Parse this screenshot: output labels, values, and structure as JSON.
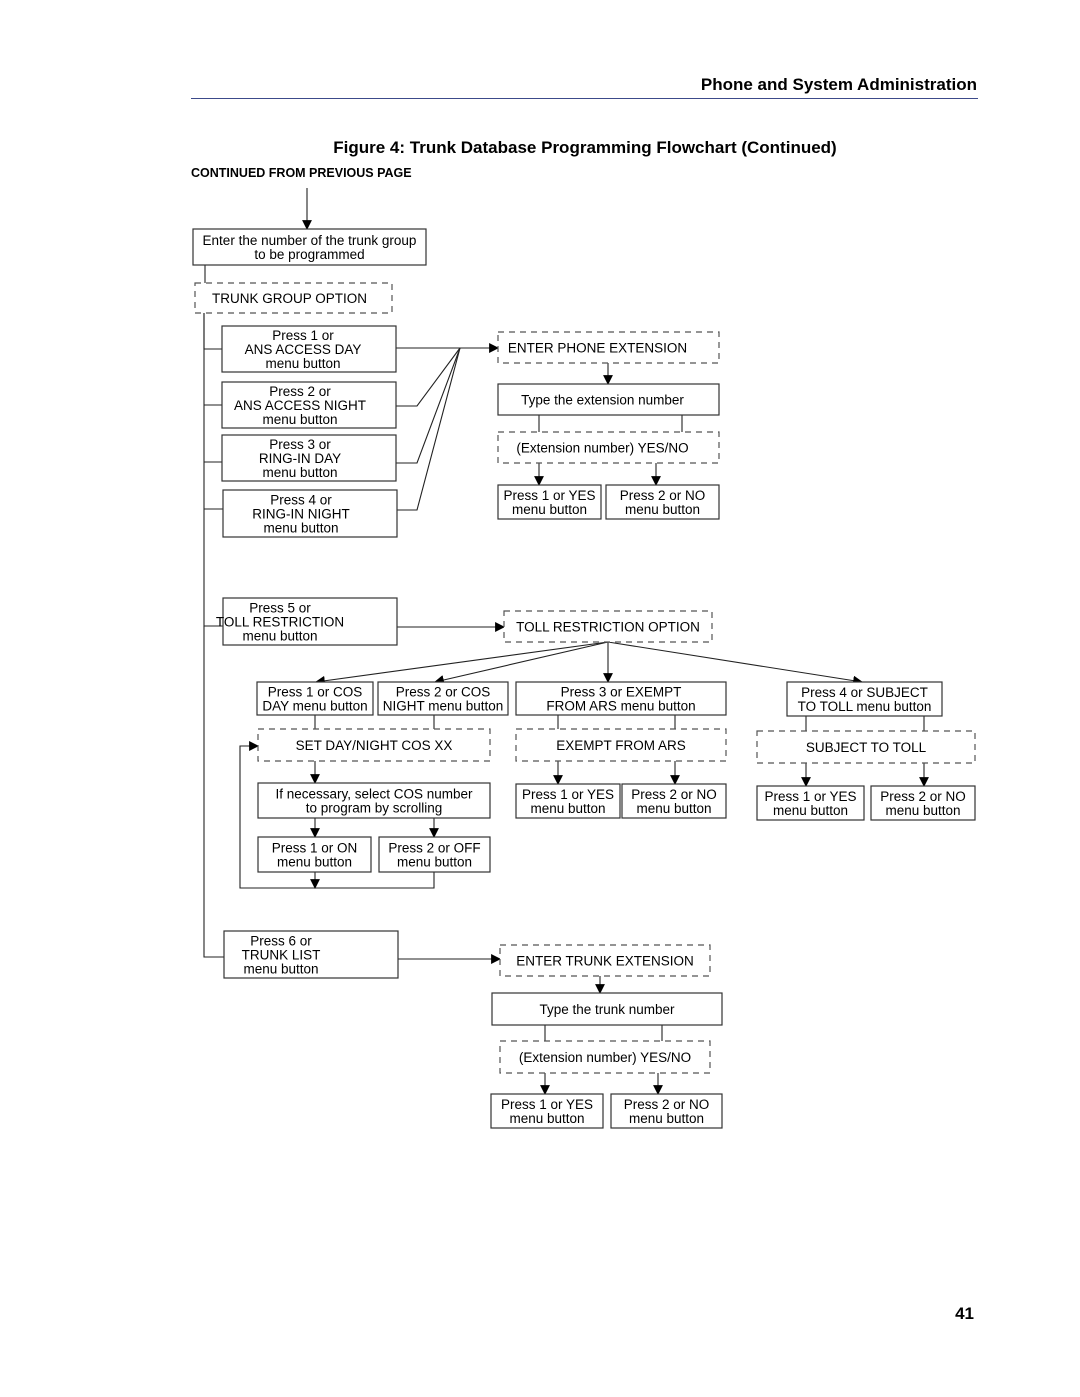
{
  "header": {
    "title": "Phone and System Administration"
  },
  "figure": {
    "title": "Figure 4: Trunk Database Programming Flowchart (Continued)"
  },
  "continued_label": "CONTINUED FROM PREVIOUS PAGE",
  "page_number": "41",
  "flowchart": {
    "nodes": [
      {
        "id": "enter-trunk-group",
        "style": "solid",
        "lines": [
          "Enter the number of the trunk group",
          "to be programmed"
        ]
      },
      {
        "id": "trunk-group-option",
        "style": "dashed",
        "lines": [
          "TRUNK GROUP OPTION"
        ]
      },
      {
        "id": "ans-access-day",
        "style": "solid",
        "lines": [
          "Press 1 or",
          "ANS ACCESS DAY",
          "menu button"
        ]
      },
      {
        "id": "ans-access-night",
        "style": "solid",
        "lines": [
          "Press 2 or",
          "ANS ACCESS NIGHT",
          "menu button"
        ]
      },
      {
        "id": "ring-in-day",
        "style": "solid",
        "lines": [
          "Press 3 or",
          "RING-IN DAY",
          "menu button"
        ]
      },
      {
        "id": "ring-in-night",
        "style": "solid",
        "lines": [
          "Press 4 or",
          "RING-IN NIGHT",
          "menu button"
        ]
      },
      {
        "id": "enter-phone-extension",
        "style": "dashed",
        "lines": [
          "ENTER PHONE EXTENSION"
        ]
      },
      {
        "id": "type-extension-number",
        "style": "solid",
        "lines": [
          "Type the extension number"
        ]
      },
      {
        "id": "extension-yes-no-1",
        "style": "dashed",
        "lines": [
          "(Extension number) YES/NO"
        ]
      },
      {
        "id": "ext-yes-1",
        "style": "solid",
        "lines": [
          "Press 1 or YES",
          "menu button"
        ]
      },
      {
        "id": "ext-no-1",
        "style": "solid",
        "lines": [
          "Press 2 or NO",
          "menu button"
        ]
      },
      {
        "id": "toll-restriction",
        "style": "solid",
        "lines": [
          "Press 5 or",
          "TOLL RESTRICTION",
          "menu button"
        ]
      },
      {
        "id": "toll-restriction-option",
        "style": "dashed",
        "lines": [
          "TOLL RESTRICTION OPTION"
        ]
      },
      {
        "id": "cos-day",
        "style": "solid",
        "lines": [
          "Press 1 or COS",
          "DAY menu button"
        ]
      },
      {
        "id": "cos-night",
        "style": "solid",
        "lines": [
          "Press 2 or COS",
          "NIGHT menu button"
        ]
      },
      {
        "id": "exempt-from-ars-button",
        "style": "solid",
        "lines": [
          "Press 3 or EXEMPT",
          "FROM ARS menu button"
        ]
      },
      {
        "id": "subject-to-toll-button",
        "style": "solid",
        "lines": [
          "Press 4 or SUBJECT",
          "TO TOLL menu button"
        ]
      },
      {
        "id": "set-day-night-cos",
        "style": "dashed",
        "lines": [
          "SET DAY/NIGHT COS XX"
        ]
      },
      {
        "id": "select-cos-number",
        "style": "solid",
        "lines": [
          "If necessary, select COS number",
          "to program by scrolling"
        ]
      },
      {
        "id": "cos-on",
        "style": "solid",
        "lines": [
          "Press 1 or ON",
          "menu button"
        ]
      },
      {
        "id": "cos-off",
        "style": "solid",
        "lines": [
          "Press 2 or OFF",
          "menu button"
        ]
      },
      {
        "id": "exempt-from-ars",
        "style": "dashed",
        "lines": [
          "EXEMPT FROM ARS"
        ]
      },
      {
        "id": "ars-yes",
        "style": "solid",
        "lines": [
          "Press 1 or YES",
          "menu button"
        ]
      },
      {
        "id": "ars-no",
        "style": "solid",
        "lines": [
          "Press 2 or NO",
          "menu button"
        ]
      },
      {
        "id": "subject-to-toll",
        "style": "dashed",
        "lines": [
          "SUBJECT TO TOLL"
        ]
      },
      {
        "id": "toll-yes",
        "style": "solid",
        "lines": [
          "Press 1 or YES",
          "menu button"
        ]
      },
      {
        "id": "toll-no",
        "style": "solid",
        "lines": [
          "Press 2 or NO",
          "menu button"
        ]
      },
      {
        "id": "trunk-list",
        "style": "solid",
        "lines": [
          "Press 6 or",
          "TRUNK LIST",
          "menu button"
        ]
      },
      {
        "id": "enter-trunk-extension",
        "style": "dashed",
        "lines": [
          "ENTER TRUNK EXTENSION"
        ]
      },
      {
        "id": "type-trunk-number",
        "style": "solid",
        "lines": [
          "Type the trunk number"
        ]
      },
      {
        "id": "extension-yes-no-2",
        "style": "dashed",
        "lines": [
          "(Extension number) YES/NO"
        ]
      },
      {
        "id": "ext-yes-2",
        "style": "solid",
        "lines": [
          "Press 1 or YES",
          "menu button"
        ]
      },
      {
        "id": "ext-no-2",
        "style": "solid",
        "lines": [
          "Press 2 or NO",
          "menu button"
        ]
      }
    ],
    "edges": [
      {
        "from": "previous-page",
        "to": "enter-trunk-group"
      },
      {
        "from": "enter-trunk-group",
        "to": "trunk-group-option"
      },
      {
        "from": "trunk-group-option",
        "to": "ans-access-day"
      },
      {
        "from": "trunk-group-option",
        "to": "ans-access-night"
      },
      {
        "from": "trunk-group-option",
        "to": "ring-in-day"
      },
      {
        "from": "trunk-group-option",
        "to": "ring-in-night"
      },
      {
        "from": "trunk-group-option",
        "to": "toll-restriction"
      },
      {
        "from": "trunk-group-option",
        "to": "trunk-list"
      },
      {
        "from": "ans-access-day",
        "to": "enter-phone-extension"
      },
      {
        "from": "ans-access-night",
        "to": "enter-phone-extension"
      },
      {
        "from": "ring-in-day",
        "to": "enter-phone-extension"
      },
      {
        "from": "ring-in-night",
        "to": "enter-phone-extension"
      },
      {
        "from": "enter-phone-extension",
        "to": "type-extension-number"
      },
      {
        "from": "type-extension-number",
        "to": "extension-yes-no-1"
      },
      {
        "from": "extension-yes-no-1",
        "to": "ext-yes-1"
      },
      {
        "from": "extension-yes-no-1",
        "to": "ext-no-1"
      },
      {
        "from": "toll-restriction",
        "to": "toll-restriction-option"
      },
      {
        "from": "toll-restriction-option",
        "to": "cos-day"
      },
      {
        "from": "toll-restriction-option",
        "to": "cos-night"
      },
      {
        "from": "toll-restriction-option",
        "to": "exempt-from-ars-button"
      },
      {
        "from": "toll-restriction-option",
        "to": "subject-to-toll-button"
      },
      {
        "from": "cos-day",
        "to": "set-day-night-cos"
      },
      {
        "from": "cos-night",
        "to": "set-day-night-cos"
      },
      {
        "from": "set-day-night-cos",
        "to": "select-cos-number"
      },
      {
        "from": "select-cos-number",
        "to": "cos-on"
      },
      {
        "from": "select-cos-number",
        "to": "cos-off"
      },
      {
        "from": "cos-on",
        "to": "set-day-night-cos"
      },
      {
        "from": "cos-off",
        "to": "set-day-night-cos"
      },
      {
        "from": "exempt-from-ars-button",
        "to": "exempt-from-ars"
      },
      {
        "from": "exempt-from-ars",
        "to": "ars-yes"
      },
      {
        "from": "exempt-from-ars",
        "to": "ars-no"
      },
      {
        "from": "subject-to-toll-button",
        "to": "subject-to-toll"
      },
      {
        "from": "subject-to-toll",
        "to": "toll-yes"
      },
      {
        "from": "subject-to-toll",
        "to": "toll-no"
      },
      {
        "from": "trunk-list",
        "to": "enter-trunk-extension"
      },
      {
        "from": "enter-trunk-extension",
        "to": "type-trunk-number"
      },
      {
        "from": "type-trunk-number",
        "to": "extension-yes-no-2"
      },
      {
        "from": "extension-yes-no-2",
        "to": "ext-yes-2"
      },
      {
        "from": "extension-yes-no-2",
        "to": "ext-no-2"
      }
    ]
  }
}
